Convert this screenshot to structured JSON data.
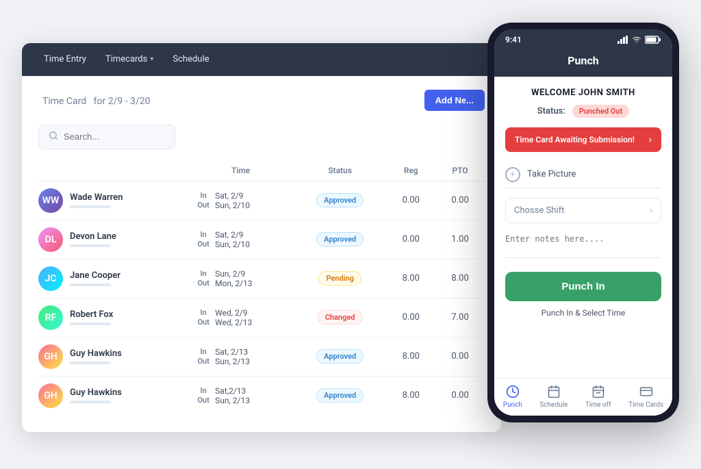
{
  "nav": {
    "items": [
      {
        "label": "Time Entry",
        "id": "time-entry"
      },
      {
        "label": "Timecards",
        "id": "timecards",
        "hasDropdown": true
      },
      {
        "label": "Schedule",
        "id": "schedule"
      }
    ]
  },
  "timecard": {
    "title": "Time Card",
    "dateRange": "for 2/9 - 3/20",
    "addNewLabel": "Add Ne...",
    "search": {
      "placeholder": "Search..."
    },
    "columns": {
      "time": "Time",
      "status": "Status",
      "reg": "Reg",
      "pto": "PTO"
    },
    "rows": [
      {
        "name": "Wade Warren",
        "initials": "WW",
        "avatarClass": "avatar-1",
        "inDay": "Sat, 2/9",
        "outDay": "Sun, 2/10",
        "status": "Approved",
        "statusClass": "badge-approved",
        "reg": "0.00",
        "pto": "0.00"
      },
      {
        "name": "Devon Lane",
        "initials": "DL",
        "avatarClass": "avatar-2",
        "inDay": "Sat, 2/9",
        "outDay": "Sun, 2/10",
        "status": "Approved",
        "statusClass": "badge-approved",
        "reg": "0.00",
        "pto": "1.00"
      },
      {
        "name": "Jane Cooper",
        "initials": "JC",
        "avatarClass": "avatar-3",
        "inDay": "Sun, 2/9",
        "outDay": "Mon, 2/13",
        "status": "Pending",
        "statusClass": "badge-pending",
        "reg": "8.00",
        "pto": "8.00"
      },
      {
        "name": "Robert Fox",
        "initials": "RF",
        "avatarClass": "avatar-4",
        "inDay": "Wed, 2/9",
        "outDay": "Wed, 2/13",
        "status": "Changed",
        "statusClass": "badge-changed",
        "reg": "0.00",
        "pto": "7.00"
      },
      {
        "name": "Guy Hawkins",
        "initials": "GH",
        "avatarClass": "avatar-5",
        "inDay": "Sat, 2/13",
        "outDay": "Sun, 2/13",
        "status": "Approved",
        "statusClass": "badge-approved",
        "reg": "8.00",
        "pto": "0.00"
      },
      {
        "name": "Guy Hawkins",
        "initials": "GH",
        "avatarClass": "avatar-5",
        "inDay": "Sat,2/13",
        "outDay": "Sun, 2/13",
        "status": "Approved",
        "statusClass": "badge-approved",
        "reg": "8.00",
        "pto": "0.00"
      }
    ]
  },
  "mobile": {
    "statusBar": {
      "time": "9:41",
      "icons": "▪▪▪ ≋ ▮"
    },
    "header": "Punch",
    "welcome": "WELCOME JOHN SMITH",
    "statusLabel": "Status:",
    "statusValue": "Punched Out",
    "alertMessage": "Time Card Awaiting Submission!",
    "takePicture": "Take Picture",
    "chooseShift": "Chosse Shift",
    "notesPlaceholder": "Enter notes here....",
    "punchInLabel": "Punch In",
    "punchSelectTime": "Punch In & Select Time",
    "navItems": [
      {
        "label": "Punch",
        "icon": "clock",
        "active": true
      },
      {
        "label": "Schedule",
        "icon": "calendar",
        "active": false
      },
      {
        "label": "Time off",
        "icon": "calendar2",
        "active": false
      },
      {
        "label": "Time Cards",
        "icon": "card",
        "active": false
      }
    ]
  }
}
